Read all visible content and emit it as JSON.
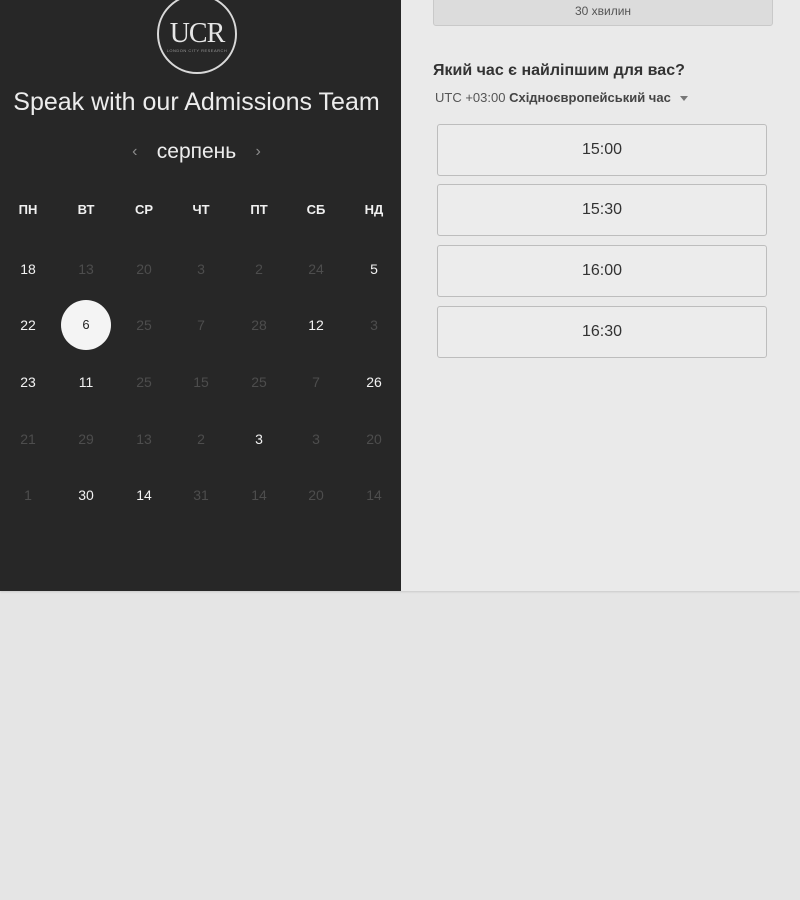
{
  "logo": {
    "text": "UCR",
    "subtext": "LONDON CITY RESEARCH"
  },
  "title": "Speak with our Admissions Team",
  "month": {
    "label": "серпень",
    "prev_icon": "chevron-left-icon",
    "next_icon": "chevron-right-icon"
  },
  "weekdays": [
    "ПН",
    "ВТ",
    "СР",
    "ЧТ",
    "ПТ",
    "СБ",
    "НД"
  ],
  "days": [
    [
      {
        "d": "18",
        "s": "active"
      },
      {
        "d": "13",
        "s": "muted"
      },
      {
        "d": "20",
        "s": "muted"
      },
      {
        "d": "3",
        "s": "muted"
      },
      {
        "d": "2",
        "s": "muted"
      },
      {
        "d": "24",
        "s": "muted"
      },
      {
        "d": "5",
        "s": "active"
      }
    ],
    [
      {
        "d": "22",
        "s": "active"
      },
      {
        "d": "6",
        "s": "selected"
      },
      {
        "d": "25",
        "s": "muted"
      },
      {
        "d": "7",
        "s": "muted"
      },
      {
        "d": "28",
        "s": "muted"
      },
      {
        "d": "12",
        "s": "active"
      },
      {
        "d": "3",
        "s": "muted"
      }
    ],
    [
      {
        "d": "23",
        "s": "active"
      },
      {
        "d": "11",
        "s": "active"
      },
      {
        "d": "25",
        "s": "muted"
      },
      {
        "d": "15",
        "s": "muted"
      },
      {
        "d": "25",
        "s": "muted"
      },
      {
        "d": "7",
        "s": "muted"
      },
      {
        "d": "26",
        "s": "active"
      }
    ],
    [
      {
        "d": "21",
        "s": "muted"
      },
      {
        "d": "29",
        "s": "muted"
      },
      {
        "d": "13",
        "s": "muted"
      },
      {
        "d": "2",
        "s": "muted"
      },
      {
        "d": "3",
        "s": "active"
      },
      {
        "d": "3",
        "s": "muted"
      },
      {
        "d": "20",
        "s": "muted"
      }
    ],
    [
      {
        "d": "1",
        "s": "muted"
      },
      {
        "d": "30",
        "s": "active"
      },
      {
        "d": "14",
        "s": "active"
      },
      {
        "d": "31",
        "s": "muted"
      },
      {
        "d": "14",
        "s": "muted"
      },
      {
        "d": "20",
        "s": "muted"
      },
      {
        "d": "14",
        "s": "muted"
      }
    ]
  ],
  "duration": "30 хвилин",
  "question": "Який час є найліпшим для вас?",
  "timezone": {
    "offset": "UTC +03:00",
    "name": "Східноєвропейський час"
  },
  "slots": [
    "15:00",
    "15:30",
    "16:00",
    "16:30"
  ],
  "colors": {
    "calendar_bg": "#272727",
    "panel_bg": "#eaeaea",
    "page_bg": "#e5e5e5",
    "selected_day": "#f4f4f4"
  }
}
